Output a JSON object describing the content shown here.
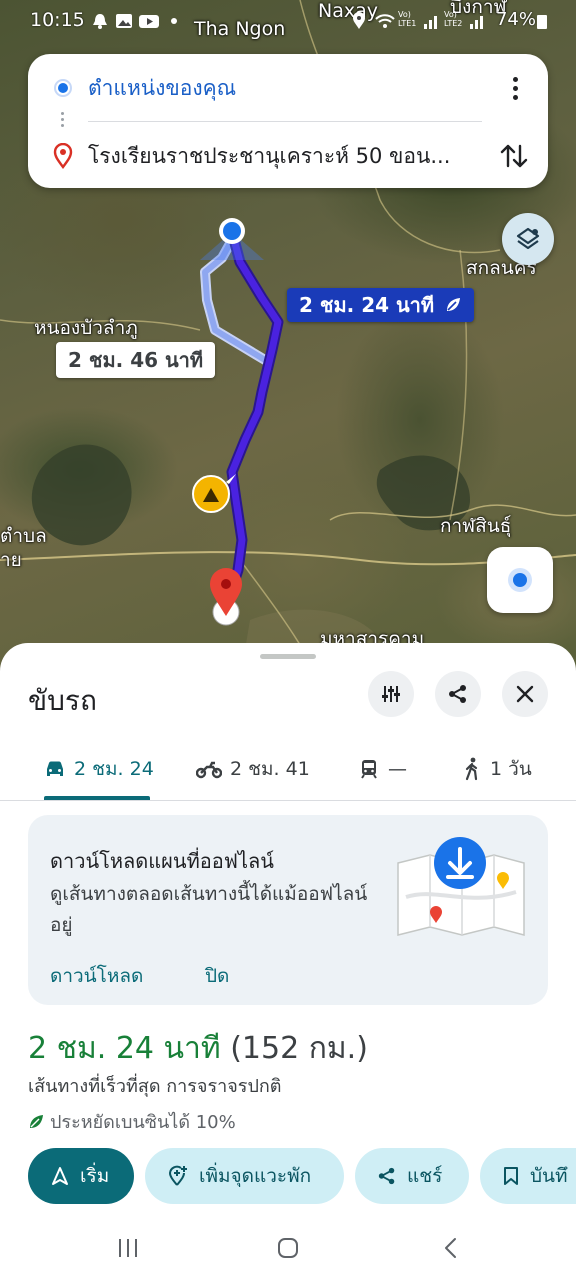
{
  "status_bar": {
    "time": "10:15",
    "battery": "74%",
    "network_label_1": "Vo) LTE1",
    "network_label_2": "Vo) LTE2"
  },
  "map": {
    "labels": {
      "top_center": "Tha Ngon",
      "top_right": "Naxay",
      "left": "หนองบัวลำภู",
      "right_top": "สกลนคร",
      "right_mid": "กาฬสินธุ์",
      "bottom_right": "มหาสารคาม",
      "left_edge_1": "ตำบล",
      "left_edge_2": "าย",
      "top_far_right": "บึงกาฬ"
    },
    "route_time_main": "2 ชม. 24 นาที",
    "route_time_alt": "2 ชม. 46 นาที",
    "route_color": "#3f1fcf",
    "alt_route_color": "#8fa7f0"
  },
  "search_card": {
    "origin": "ตำแหน่งของคุณ",
    "destination": "โรงเรียนราชประชานุเคราะห์ 50 ขอน..."
  },
  "sheet": {
    "title": "ขับรถ",
    "modes": [
      {
        "label": "2 ชม. 24",
        "icon": "car-icon"
      },
      {
        "label": "2 ชม. 41",
        "icon": "motorcycle-icon"
      },
      {
        "label": "—",
        "icon": "train-icon"
      },
      {
        "label": "1 วัน",
        "icon": "walk-icon"
      }
    ],
    "offline": {
      "title": "ดาวน์โหลดแผนที่ออฟไลน์",
      "description": "ดูเส้นทางตลอดเส้นทางนี้ได้แม้ออฟไลน์อยู่",
      "download": "ดาวน์โหลด",
      "close": "ปิด"
    },
    "duration": "2 ชม. 24 นาที",
    "distance": "(152 กม.)",
    "route_description": "เส้นทางที่เร็วที่สุด การจราจรปกติ",
    "eco_note": "ประหยัดเบนซินได้ 10%",
    "actions": {
      "start": "เริ่ม",
      "add_stop": "เพิ่มจุดแวะพัก",
      "share": "แชร์",
      "save": "บันทึ"
    }
  },
  "colors": {
    "accent": "#0b6b78",
    "green": "#188038",
    "blue": "#1a73e8"
  }
}
